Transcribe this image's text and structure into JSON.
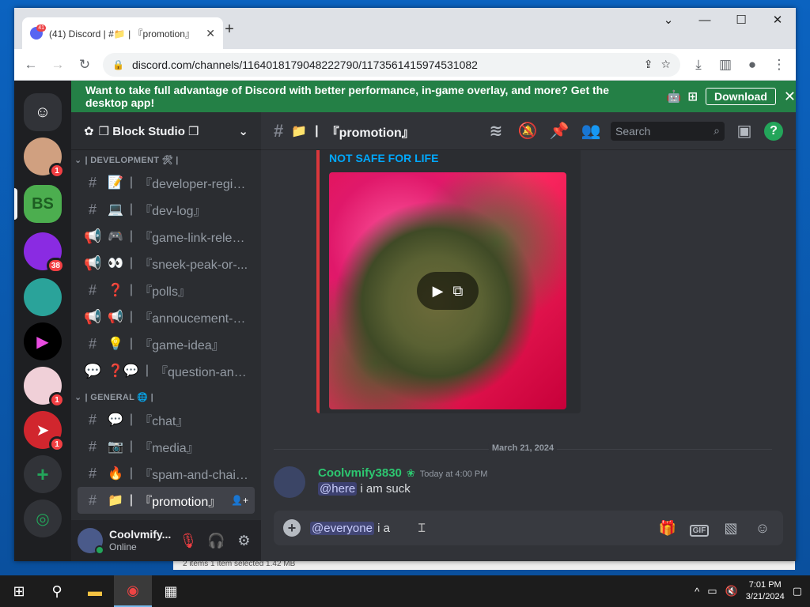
{
  "browser": {
    "tab_title": "(41) Discord | #📁 | 『promotion』",
    "tab_badge": "41",
    "url": "discord.com/channels/1164018179048222790/1173561415974531082"
  },
  "banner": {
    "text": "Want to take full advantage of Discord with better performance, in-game overlay, and more? Get the desktop app!",
    "download_label": "Download"
  },
  "guilds": [
    {
      "name": "home",
      "badge": ""
    },
    {
      "name": "server-1",
      "badge": "1"
    },
    {
      "name": "block-studio",
      "badge": ""
    },
    {
      "name": "server-3",
      "badge": "38"
    },
    {
      "name": "server-4",
      "badge": ""
    },
    {
      "name": "server-5",
      "badge": ""
    },
    {
      "name": "server-6",
      "badge": "1"
    },
    {
      "name": "server-7",
      "badge": "1"
    }
  ],
  "server": {
    "name": "❒ Block Studio ❒",
    "categories": [
      {
        "label": "| DEVELOPMENT 🛠 |"
      },
      {
        "label": "| GENERAL 🌐 |"
      }
    ],
    "channels_dev": [
      {
        "icon": "#",
        "emoji": "📝",
        "label": "『developer-regist..."
      },
      {
        "icon": "#",
        "emoji": "💻",
        "label": "『dev-log』"
      },
      {
        "icon": "📢",
        "emoji": "🎮",
        "label": "『game-link-releas..."
      },
      {
        "icon": "📢",
        "emoji": "👀",
        "label": "『sneek-peak-or-..."
      },
      {
        "icon": "#",
        "emoji": "❓",
        "label": "『polls』"
      },
      {
        "icon": "📢",
        "emoji": "📢",
        "label": "『annoucement-d..."
      },
      {
        "icon": "#",
        "emoji": "💡",
        "label": "『game-idea』"
      },
      {
        "icon": "💬",
        "emoji": "❓💬",
        "label": "『question-and-an..."
      }
    ],
    "channels_general": [
      {
        "icon": "#",
        "emoji": "💬",
        "label": "『chat』"
      },
      {
        "icon": "#",
        "emoji": "📷",
        "label": "『media』"
      },
      {
        "icon": "#",
        "emoji": "🔥",
        "label": "『spam-and-chain』"
      },
      {
        "icon": "#",
        "emoji": "📁",
        "label": "『promotion』"
      }
    ]
  },
  "user": {
    "name": "Coolvmify...",
    "status": "Online"
  },
  "channel": {
    "emoji": "📁",
    "name": "『promotion』",
    "search_placeholder": "Search"
  },
  "embed": {
    "title": "NOT SAFE FOR LIFE"
  },
  "date_divider": "March 21, 2024",
  "message": {
    "author": "Coolvmify3830",
    "time": "Today at 4:00 PM",
    "mention": "@here",
    "text": "i am suck"
  },
  "composer": {
    "mention": "@everyone",
    "text": "i a"
  },
  "explorer_status": "2 items     1 item selected  1.42 MB",
  "taskbar": {
    "time": "7:01 PM",
    "date": "3/21/2024"
  }
}
